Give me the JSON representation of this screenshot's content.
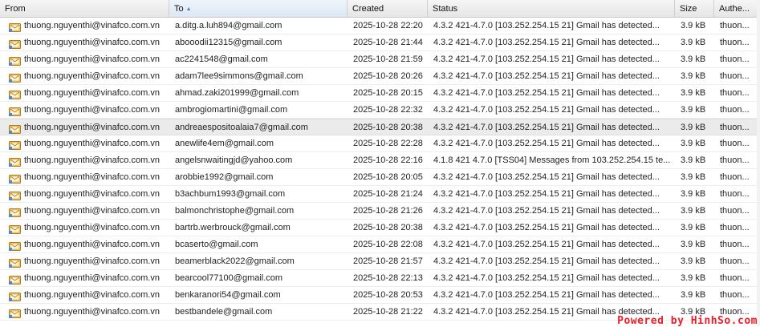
{
  "columns": {
    "from": "From",
    "to": "To",
    "created": "Created",
    "status": "Status",
    "size": "Size",
    "auth": "Authe..."
  },
  "sort": {
    "column": "to",
    "direction": "ascending"
  },
  "accent_colors": {
    "row_selected": "#ebebeb",
    "sort_arrow": "#4a7fc0",
    "icon_envelope": "#e8a020"
  },
  "rows": [
    {
      "from": "thuong.nguyenthi@vinafco.com.vn",
      "to": "a.ditg.a.luh894@gmail.com",
      "created": "2025-10-28 22:20",
      "status": "4.3.2 421-4.7.0 [103.252.254.15      21] Gmail has detected...",
      "size": "3.9 kB",
      "auth": "thuon..."
    },
    {
      "from": "thuong.nguyenthi@vinafco.com.vn",
      "to": "abooodii12315@gmail.com",
      "created": "2025-10-28 21:44",
      "status": "4.3.2 421-4.7.0 [103.252.254.15      21] Gmail has detected...",
      "size": "3.9 kB",
      "auth": "thuon..."
    },
    {
      "from": "thuong.nguyenthi@vinafco.com.vn",
      "to": "ac2241548@gmail.com",
      "created": "2025-10-28 21:59",
      "status": "4.3.2 421-4.7.0 [103.252.254.15      21] Gmail has detected...",
      "size": "3.9 kB",
      "auth": "thuon..."
    },
    {
      "from": "thuong.nguyenthi@vinafco.com.vn",
      "to": "adam7lee9simmons@gmail.com",
      "created": "2025-10-28 20:26",
      "status": "4.3.2 421-4.7.0 [103.252.254.15      21] Gmail has detected...",
      "size": "3.9 kB",
      "auth": "thuon..."
    },
    {
      "from": "thuong.nguyenthi@vinafco.com.vn",
      "to": "ahmad.zaki201999@gmail.com",
      "created": "2025-10-28 20:15",
      "status": "4.3.2 421-4.7.0 [103.252.254.15      21] Gmail has detected...",
      "size": "3.9 kB",
      "auth": "thuon..."
    },
    {
      "from": "thuong.nguyenthi@vinafco.com.vn",
      "to": "ambrogiomartini@gmail.com",
      "created": "2025-10-28 22:32",
      "status": "4.3.2 421-4.7.0 [103.252.254.15      21] Gmail has detected...",
      "size": "3.9 kB",
      "auth": "thuon..."
    },
    {
      "from": "thuong.nguyenthi@vinafco.com.vn",
      "to": "andreaespositoalaia7@gmail.com",
      "created": "2025-10-28 20:38",
      "status": "4.3.2 421-4.7.0 [103.252.254.15      21] Gmail has detected...",
      "size": "3.9 kB",
      "auth": "thuon...",
      "selected": true
    },
    {
      "from": "thuong.nguyenthi@vinafco.com.vn",
      "to": "anewlife4em@gmail.com",
      "created": "2025-10-28 22:28",
      "status": "4.3.2 421-4.7.0 [103.252.254.15      21] Gmail has detected...",
      "size": "3.9 kB",
      "auth": "thuon..."
    },
    {
      "from": "thuong.nguyenthi@vinafco.com.vn",
      "to": "angelsnwaitingjd@yahoo.com",
      "created": "2025-10-28 22:16",
      "status": "4.1.8 421 4.7.0 [TSS04] Messages from 103.252.254.15 te...",
      "size": "3.9 kB",
      "auth": "thuon..."
    },
    {
      "from": "thuong.nguyenthi@vinafco.com.vn",
      "to": "arobbie1992@gmail.com",
      "created": "2025-10-28 20:05",
      "status": "4.3.2 421-4.7.0 [103.252.254.15      21] Gmail has detected...",
      "size": "3.9 kB",
      "auth": "thuon..."
    },
    {
      "from": "thuong.nguyenthi@vinafco.com.vn",
      "to": "b3achbum1993@gmail.com",
      "created": "2025-10-28 21:24",
      "status": "4.3.2 421-4.7.0 [103.252.254.15      21] Gmail has detected...",
      "size": "3.9 kB",
      "auth": "thuon..."
    },
    {
      "from": "thuong.nguyenthi@vinafco.com.vn",
      "to": "balmonchristophe@gmail.com",
      "created": "2025-10-28 21:26",
      "status": "4.3.2 421-4.7.0 [103.252.254.15      21] Gmail has detected...",
      "size": "3.9 kB",
      "auth": "thuon..."
    },
    {
      "from": "thuong.nguyenthi@vinafco.com.vn",
      "to": "bartrb.werbrouck@gmail.com",
      "created": "2025-10-28 20:38",
      "status": "4.3.2 421-4.7.0 [103.252.254.15      21] Gmail has detected...",
      "size": "3.9 kB",
      "auth": "thuon..."
    },
    {
      "from": "thuong.nguyenthi@vinafco.com.vn",
      "to": "bcaserto@gmail.com",
      "created": "2025-10-28 22:08",
      "status": "4.3.2 421-4.7.0 [103.252.254.15      21] Gmail has detected...",
      "size": "3.9 kB",
      "auth": "thuon..."
    },
    {
      "from": "thuong.nguyenthi@vinafco.com.vn",
      "to": "beamerblack2022@gmail.com",
      "created": "2025-10-28 21:57",
      "status": "4.3.2 421-4.7.0 [103.252.254.15      21] Gmail has detected...",
      "size": "3.9 kB",
      "auth": "thuon..."
    },
    {
      "from": "thuong.nguyenthi@vinafco.com.vn",
      "to": "bearcool77100@gmail.com",
      "created": "2025-10-28 22:13",
      "status": "4.3.2 421-4.7.0 [103.252.254.15      21] Gmail has detected...",
      "size": "3.9 kB",
      "auth": "thuon..."
    },
    {
      "from": "thuong.nguyenthi@vinafco.com.vn",
      "to": "benkaranori54@gmail.com",
      "created": "2025-10-28 20:53",
      "status": "4.3.2 421-4.7.0 [103.252.254.15      21] Gmail has detected...",
      "size": "3.9 kB",
      "auth": "thuon..."
    },
    {
      "from": "thuong.nguyenthi@vinafco.com.vn",
      "to": "bestbandele@gmail.com",
      "created": "2025-10-28 21:22",
      "status": "4.3.2 421-4.7.0 [103.252.254.15      21] Gmail has detected...",
      "size": "3.9 kB",
      "auth": "thuon..."
    }
  ],
  "watermark": "Powered by HinhSo.com"
}
